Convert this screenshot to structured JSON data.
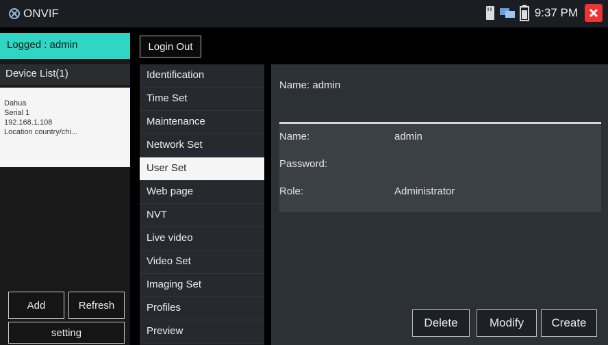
{
  "app": {
    "title": "ONVIF",
    "clock": "9:37 PM"
  },
  "colors": {
    "accent": "#2fd6c3",
    "close": "#e33333"
  },
  "left": {
    "logged": "Logged : admin",
    "device_list": "Device List(1)",
    "device": {
      "lines": [
        "Dahua",
        "Serial 1",
        "192.168.1.108",
        "Location country/chi..."
      ]
    },
    "add": "Add",
    "refresh": "Refresh",
    "setting": "setting"
  },
  "toolbar": {
    "logout": "Login Out"
  },
  "menu": {
    "items": [
      "Identification",
      "Time Set",
      "Maintenance",
      "Network Set",
      "User Set",
      "Web page",
      "NVT",
      "Live video",
      "Video Set",
      "Imaging Set",
      "Profiles",
      "Preview"
    ],
    "active_index": 4
  },
  "content": {
    "header": "Name: admin",
    "fields": {
      "name_label": "Name:",
      "name_value": "admin",
      "password_label": "Password:",
      "password_value": "",
      "role_label": "Role:",
      "role_value": "Administrator"
    },
    "buttons": {
      "delete": "Delete",
      "modify": "Modify",
      "create": "Create"
    }
  }
}
